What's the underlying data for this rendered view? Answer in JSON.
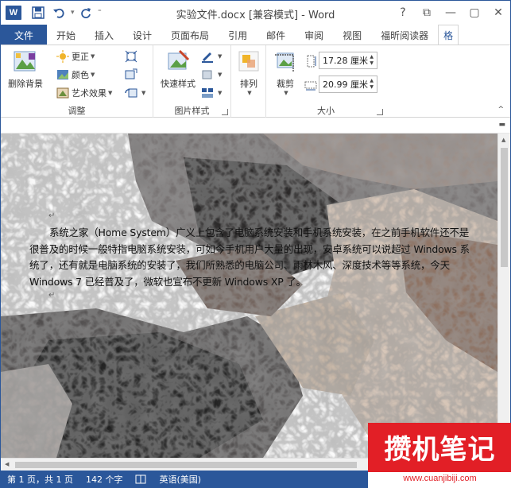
{
  "window": {
    "title": "实验文件.docx [兼容模式] - Word",
    "help": "?",
    "ribbon_display": "⧉",
    "minimize": "—",
    "restore": "▢",
    "close": "✕"
  },
  "qat": {
    "app_icon": "W",
    "save_icon": "save-icon",
    "undo_icon": "undo-icon",
    "redo_icon": "redo-icon"
  },
  "tabs": [
    {
      "label": "文件"
    },
    {
      "label": "开始"
    },
    {
      "label": "插入"
    },
    {
      "label": "设计"
    },
    {
      "label": "页面布局"
    },
    {
      "label": "引用"
    },
    {
      "label": "邮件"
    },
    {
      "label": "审阅"
    },
    {
      "label": "视图"
    },
    {
      "label": "福昕阅读器"
    },
    {
      "label": "格"
    }
  ],
  "ribbon": {
    "adjust": {
      "remove_bg": "删除背景",
      "corrections": "更正",
      "color": "颜色",
      "artistic": "艺术效果",
      "label": "调整"
    },
    "picture_styles": {
      "quick_styles": "快速样式",
      "label": "图片样式"
    },
    "arrange": {
      "arrange": "排列"
    },
    "size": {
      "crop": "裁剪",
      "height": "17.28 厘米",
      "width": "20.99 厘米",
      "label": "大小"
    }
  },
  "document": {
    "paragraph": "系统之家（Home System）广义上包含了电脑系统安装和手机系统安装，在之前手机软件还不是很普及的时候一般特指电脑系统安装，可如今手机用户大量的出现，安卓系统可以说超过 Windows 系统了，还有就是电脑系统的安装了，我们所熟悉的电脑公司、雨林木风、深度技术等等系统，今天 Windows 7 已经普及了，微软也宣布不更新 Windows XP 了。",
    "return_mark": "↵"
  },
  "status": {
    "page": "第 1 页，共 1 页",
    "words": "142 个字",
    "language": "英语(美国)"
  },
  "watermark": {
    "brand": "攒机笔记",
    "url": "www.cuanjibiji.com"
  },
  "colors": {
    "accent": "#2b579a",
    "watermark_red": "#e21f26"
  }
}
